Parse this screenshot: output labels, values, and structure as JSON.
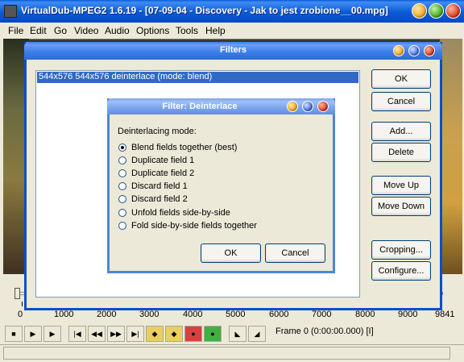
{
  "main_window": {
    "title": "VirtualDub-MPEG2 1.6.19 - [07-09-04 - Discovery - Jak to jest zrobione__00.mpg]",
    "menu": [
      "File",
      "Edit",
      "Go",
      "Video",
      "Audio",
      "Options",
      "Tools",
      "Help"
    ]
  },
  "timeline": {
    "ticks": [
      "0",
      "1000",
      "2000",
      "3000",
      "4000",
      "5000",
      "6000",
      "7000",
      "8000",
      "9000",
      "9841"
    ],
    "position": 0
  },
  "status": {
    "frame_readout": "Frame 0 (0:00:00.000) [I]"
  },
  "filters_dialog": {
    "title": "Filters",
    "filter_list": [
      "544x576  544x576  deinterlace (mode: blend)"
    ],
    "buttons": {
      "ok": "OK",
      "cancel": "Cancel",
      "add": "Add...",
      "delete": "Delete",
      "move_up": "Move Up",
      "move_down": "Move Down",
      "cropping": "Cropping...",
      "configure": "Configure..."
    }
  },
  "deinterlace_dialog": {
    "title": "Filter: Deinterlace",
    "mode_label": "Deinterlacing mode:",
    "options": [
      "Blend fields together (best)",
      "Duplicate field 1",
      "Duplicate field 2",
      "Discard field 1",
      "Discard field 2",
      "Unfold fields side-by-side",
      "Fold side-by-side fields together"
    ],
    "selected_index": 0,
    "buttons": {
      "ok": "OK",
      "cancel": "Cancel"
    }
  }
}
